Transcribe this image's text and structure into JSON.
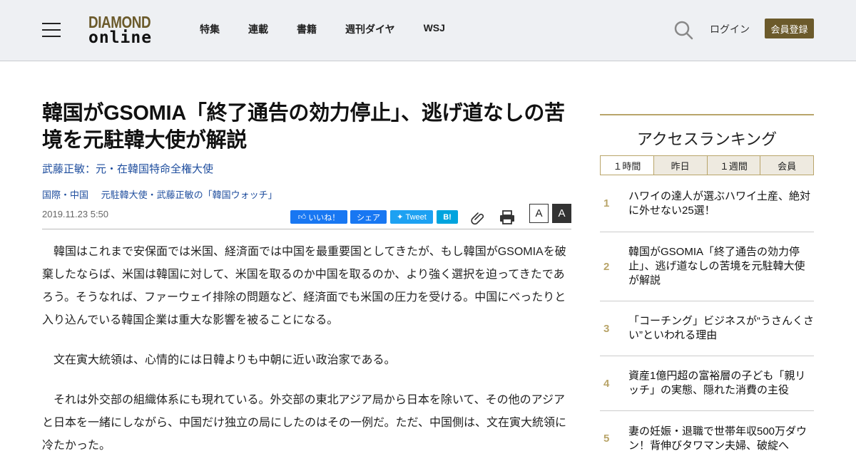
{
  "header": {
    "logo_top": "DIAMOND",
    "logo_bottom": "online",
    "nav": [
      "特集",
      "連載",
      "書籍",
      "週刊ダイヤ",
      "WSJ"
    ],
    "login": "ログイン",
    "register": "会員登録"
  },
  "article": {
    "title": "韓国がGSOMIA「終了通告の効力停止」、逃げ道なしの苦境を元駐韓大使が解説",
    "author": "武藤正敏：元・在韓国特命全権大使",
    "categories": [
      "国際・中国",
      "元駐韓大使・武藤正敏の「韓国ウォッチ」"
    ],
    "date": "2019.11.23 5:50",
    "share": {
      "like": "いいね！",
      "share": "シェア",
      "tweet": "Tweet",
      "hatena": "B!"
    },
    "font_small": "A",
    "font_large": "A",
    "paragraphs": [
      "韓国はこれまで安保面では米国、経済面では中国を最重要国としてきたが、もし韓国がGSOMIAを破棄したならば、米国は韓国に対して、米国を取るのか中国を取るのか、より強く選択を迫ってきたであろう。そうなれば、ファーウェイ排除の問題など、経済面でも米国の圧力を受ける。中国にべったりと入り込んでいる韓国企業は重大な影響を被ることになる。",
      "文在寅大統領は、心情的には日韓よりも中朝に近い政治家である。",
      "それは外交部の組織体系にも現れている。外交部の東北アジア局から日本を除いて、その他のアジアと日本を一緒にしながら、中国だけ独立の局にしたのはその一例だ。ただ、中国側は、文在寅大統領に冷たかった。"
    ]
  },
  "ranking": {
    "title": "アクセスランキング",
    "tabs": [
      "１時間",
      "昨日",
      "１週間",
      "会員"
    ],
    "items": [
      {
        "rank": "1",
        "text": "ハワイの達人が選ぶハワイ土産、絶対に外せない25選！"
      },
      {
        "rank": "2",
        "text": "韓国がGSOMIA「終了通告の効力停止」、逃げ道なしの苦境を元駐韓大使が解説"
      },
      {
        "rank": "3",
        "text": "「コーチング」ビジネスが“うさんくさい”といわれる理由"
      },
      {
        "rank": "4",
        "text": "資産1億円超の富裕層の子ども「親リッチ」の実態、隠れた消費の主役"
      },
      {
        "rank": "5",
        "text": "妻の妊娠・退職で世帯年収500万ダウン！背伸びタワマン夫婦、破綻へ"
      }
    ]
  },
  "colors": {
    "brand": "#6b5a2b",
    "link": "#1f4e9e",
    "accent_gold": "#b9a56a"
  }
}
